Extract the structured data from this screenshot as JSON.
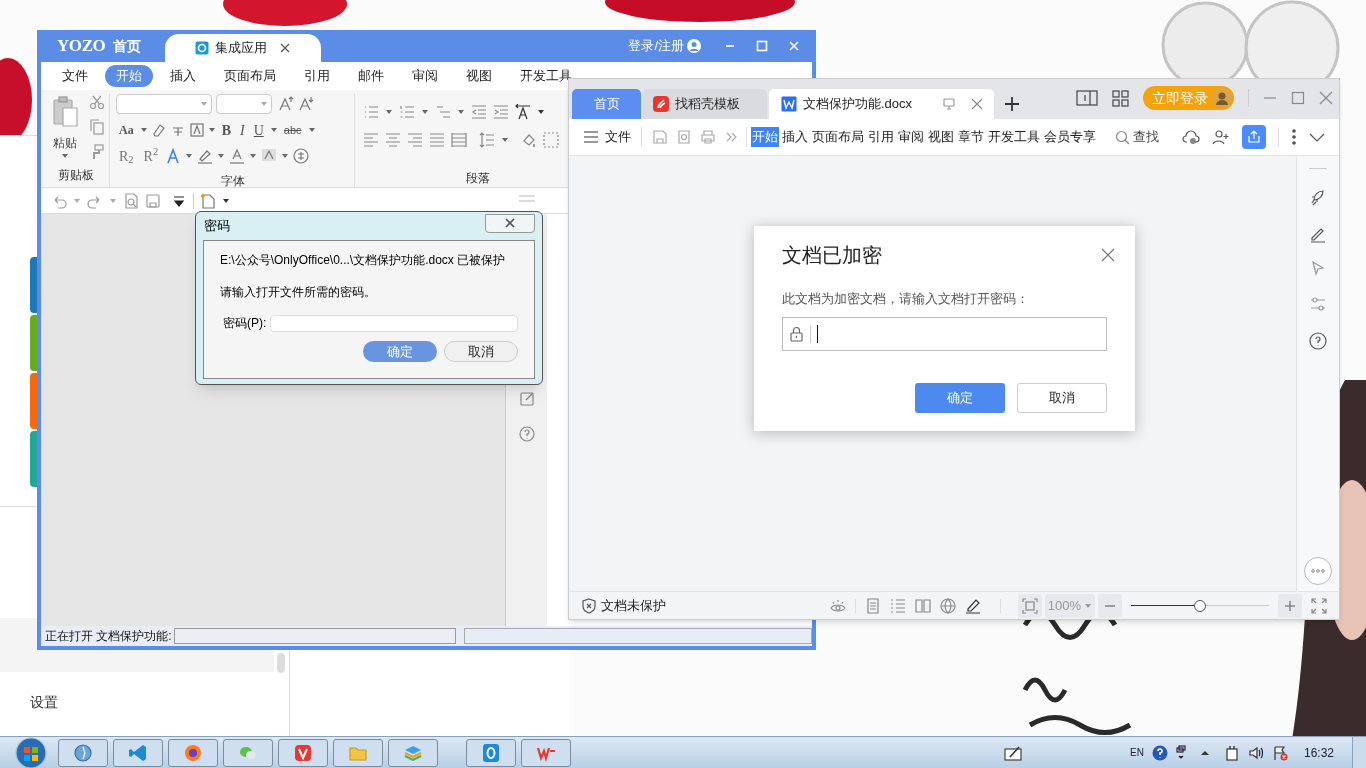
{
  "background_window": {
    "color_tabs": [
      {
        "color": "#1d7ab8"
      },
      {
        "color": "#6aaa1e"
      },
      {
        "color": "#f26a0c"
      },
      {
        "color": "#20a898"
      }
    ],
    "sidebar_items": [
      {
        "label": "设置",
        "selected": false
      }
    ]
  },
  "yozo": {
    "logo": "YOZO",
    "home": "首页",
    "tabs": [
      {
        "label": "集成应用",
        "selected": true
      }
    ],
    "login": "登录/注册",
    "menu": [
      {
        "label": "文件",
        "selected": false
      },
      {
        "label": "开始",
        "selected": true
      },
      {
        "label": "插入",
        "selected": false
      },
      {
        "label": "页面布局",
        "selected": false
      },
      {
        "label": "引用",
        "selected": false
      },
      {
        "label": "邮件",
        "selected": false
      },
      {
        "label": "审阅",
        "selected": false
      },
      {
        "label": "视图",
        "selected": false
      },
      {
        "label": "开发工具",
        "selected": false
      }
    ],
    "paste_label": "粘贴",
    "format_buttons": [
      "Aa",
      "B",
      "I",
      "U",
      "abc"
    ],
    "script_buttons": [
      "R$_{2}$",
      "R$^{2}$"
    ],
    "ribbon_groups": [
      "剪贴板",
      "字体",
      "段落"
    ],
    "status": "正在打开 文档保护功能:",
    "progress": {
      "level": 0
    }
  },
  "yozo_dialog": {
    "title": "密码",
    "message": "E:\\公众号\\OnlyOffice\\0...\\文档保护功能.docx 已被保护",
    "prompt": "请输入打开文件所需的密码。",
    "field_label": "密码(P):",
    "buttons": [
      {
        "label": "确定",
        "primary": true
      },
      {
        "label": "取消",
        "primary": false
      }
    ]
  },
  "wps": {
    "tabs": [
      {
        "label": "首页",
        "selected": false,
        "kind": "home"
      },
      {
        "label": "找稻壳模板",
        "selected": false,
        "kind": "template"
      },
      {
        "label": "文档保护功能.docx",
        "selected": true,
        "kind": "document"
      }
    ],
    "login": "立即登录",
    "file_menu": "文件",
    "menu": [
      {
        "label": "开始",
        "selected": true
      },
      {
        "label": "插入",
        "selected": false
      },
      {
        "label": "页面布局",
        "selected": false
      },
      {
        "label": "引用",
        "selected": false
      },
      {
        "label": "审阅",
        "selected": false
      },
      {
        "label": "视图",
        "selected": false
      },
      {
        "label": "章节",
        "selected": false
      },
      {
        "label": "开发工具",
        "selected": false
      },
      {
        "label": "会员专享",
        "selected": false
      }
    ],
    "search": "查找",
    "status": "文档未保护",
    "zoom": "100%",
    "zoom_slider": {
      "level": 0.5
    }
  },
  "wps_dialog": {
    "title": "文档已加密",
    "prompt": "此文档为加密文档，请输入文档打开密码：",
    "buttons": [
      {
        "label": "确定",
        "primary": true
      },
      {
        "label": "取消",
        "primary": false
      }
    ]
  },
  "taskbar": {
    "language": "EN",
    "time": "16:32"
  }
}
